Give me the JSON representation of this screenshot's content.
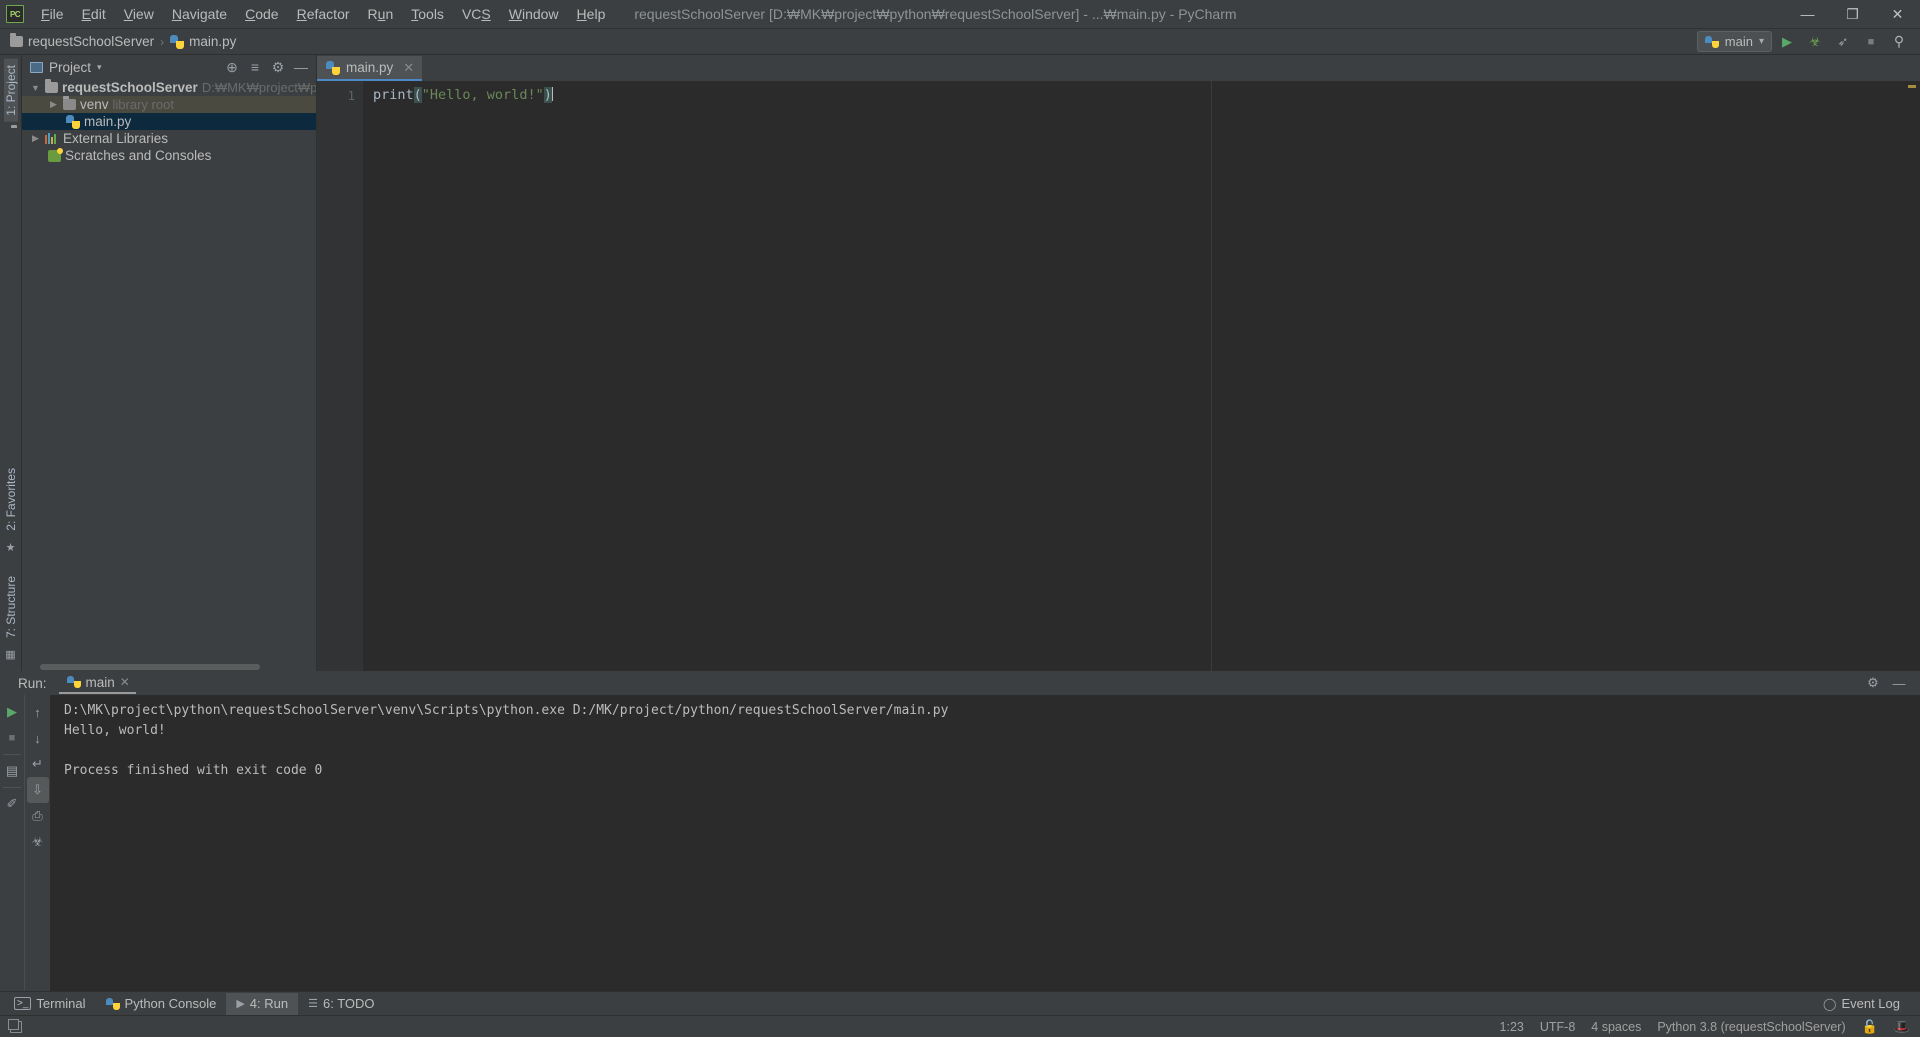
{
  "window": {
    "title": "requestSchoolServer [D:₩MK₩project₩python₩requestSchoolServer] - ...₩main.py - PyCharm",
    "logo": "PC",
    "minimize": "—",
    "maximize": "❐",
    "close": "✕"
  },
  "menu": [
    {
      "label": "File",
      "mnemonic": "F"
    },
    {
      "label": "Edit",
      "mnemonic": "E"
    },
    {
      "label": "View",
      "mnemonic": "V"
    },
    {
      "label": "Navigate",
      "mnemonic": "N"
    },
    {
      "label": "Code",
      "mnemonic": "C"
    },
    {
      "label": "Refactor",
      "mnemonic": "R"
    },
    {
      "label": "Run",
      "mnemonic": "u"
    },
    {
      "label": "Tools",
      "mnemonic": "T"
    },
    {
      "label": "VCS",
      "mnemonic": "S"
    },
    {
      "label": "Window",
      "mnemonic": "W"
    },
    {
      "label": "Help",
      "mnemonic": "H"
    }
  ],
  "navbar": {
    "crumbs": [
      {
        "label": "requestSchoolServer",
        "icon": "folder-icon"
      },
      {
        "label": "main.py",
        "icon": "python-file-icon"
      }
    ],
    "separator": "›",
    "run_config": {
      "label": "main",
      "icon": "python-icon",
      "caret": "▾"
    },
    "actions": [
      {
        "name": "run-button",
        "glyph": "▶",
        "color": "#59a869"
      },
      {
        "name": "debug-button",
        "glyph": "☢",
        "color": "#6ea84f"
      },
      {
        "name": "run-with-coverage-button",
        "glyph": "➦",
        "color": "#9aa0a6"
      },
      {
        "name": "stop-button",
        "glyph": "■",
        "color": "#7a7d7e"
      },
      {
        "name": "search-everywhere-icon",
        "glyph": "⚲",
        "color": "#b0b0b0"
      }
    ]
  },
  "rail": {
    "top": [
      {
        "label": "1: Project",
        "active": true
      }
    ],
    "bottom": [
      {
        "label": "2: Favorites",
        "icon": "star-icon"
      },
      {
        "label": "7: Structure",
        "icon": "structure-icon"
      }
    ]
  },
  "project_panel": {
    "title": "Project",
    "caret": "▾",
    "actions": [
      {
        "name": "locate-in-tree-icon",
        "glyph": "⊕"
      },
      {
        "name": "collapse-all-icon",
        "glyph": "≡"
      },
      {
        "name": "settings-gear-icon",
        "glyph": "⚙"
      },
      {
        "name": "hide-panel-icon",
        "glyph": "—"
      }
    ],
    "tree": [
      {
        "label": "requestSchoolServer",
        "sub": "D:₩MK₩project₩python₩reques",
        "icon": "folder-icon",
        "twisty": "▼",
        "indent": 1,
        "bold": true,
        "state": "normal"
      },
      {
        "label": "venv",
        "sub": "library root",
        "icon": "folder-icon",
        "twisty": "▶",
        "indent": 2,
        "bold": false,
        "state": "hover"
      },
      {
        "label": "main.py",
        "sub": "",
        "icon": "python-file-icon",
        "twisty": "",
        "indent": 3,
        "bold": false,
        "state": "selected"
      },
      {
        "label": "External Libraries",
        "sub": "",
        "icon": "library-icon",
        "twisty": "▶",
        "indent": 1,
        "bold": false,
        "state": "normal"
      },
      {
        "label": "Scratches and Consoles",
        "sub": "",
        "icon": "scratches-icon",
        "twisty": "",
        "indent": 2,
        "bold": false,
        "state": "normal"
      }
    ]
  },
  "editor": {
    "tabs": [
      {
        "label": "main.py",
        "icon": "python-file-icon",
        "close": "✕",
        "active": true
      }
    ],
    "line_numbers": [
      "1"
    ],
    "code": {
      "function": "print",
      "open_paren": "(",
      "string": "\"Hello, world!\"",
      "close_paren": ")"
    }
  },
  "run_window": {
    "label": "Run:",
    "tab": {
      "label": "main",
      "icon": "python-icon",
      "close": "✕"
    },
    "header_actions": [
      {
        "name": "run-settings-gear-icon",
        "glyph": "⚙"
      },
      {
        "name": "hide-run-panel-icon",
        "glyph": "—"
      }
    ],
    "left_tools": [
      {
        "name": "rerun-button",
        "glyph": "▶",
        "color": "#59a869"
      },
      {
        "name": "stop-process-button",
        "glyph": "■",
        "color": "#6e7072"
      },
      {
        "name": "show-running-list-button",
        "glyph": "▤",
        "color": "#9aa0a6"
      },
      {
        "name": "pin-tab-button",
        "glyph": "✐",
        "color": "#9aa0a6"
      }
    ],
    "right_tools": [
      {
        "name": "scroll-up-button",
        "glyph": "↑",
        "color": "#8b8f91"
      },
      {
        "name": "scroll-down-button",
        "glyph": "↓",
        "color": "#8b8f91"
      },
      {
        "name": "soft-wrap-button",
        "glyph": "↵",
        "color": "#9aa0a6"
      },
      {
        "name": "scroll-to-end-button",
        "glyph": "⇩",
        "color": "#9aa0a6",
        "active": true
      },
      {
        "name": "print-button",
        "glyph": "⎙",
        "color": "#9aa0a6"
      },
      {
        "name": "clear-all-button",
        "glyph": "Ὕ1",
        "color": "#9aa0a6"
      }
    ],
    "console_lines": [
      "D:\\MK\\project\\python\\requestSchoolServer\\venv\\Scripts\\python.exe D:/MK/project/python/requestSchoolServer/main.py",
      "Hello, world!",
      "",
      "Process finished with exit code 0"
    ]
  },
  "bottom_bar": {
    "items": [
      {
        "label": "Terminal",
        "icon": "terminal-icon",
        "active": false
      },
      {
        "label": "Python Console",
        "icon": "python-console-icon",
        "active": false
      },
      {
        "label": "4: Run",
        "icon": "run-icon",
        "active": true
      },
      {
        "label": "6: TODO",
        "icon": "todo-icon",
        "active": false
      }
    ],
    "event_log": {
      "label": "Event Log",
      "icon": "balloon-icon"
    }
  },
  "status_bar": {
    "left_icon": "show-tool-windows-icon",
    "caret_position": "1:23",
    "encoding": "UTF-8",
    "indent": "4 spaces",
    "interpreter": "Python 3.8 (requestSchoolServer)",
    "lock_icon": "unlock-icon",
    "inspection_icon": "hector-hat-icon"
  },
  "colors": {
    "background": "#3c3f41",
    "editor_bg": "#2b2b2b",
    "selection": "#0d293e",
    "hover": "#4b4a41",
    "accent": "#4a88c7",
    "string": "#6a8759",
    "run_green": "#59a869"
  }
}
